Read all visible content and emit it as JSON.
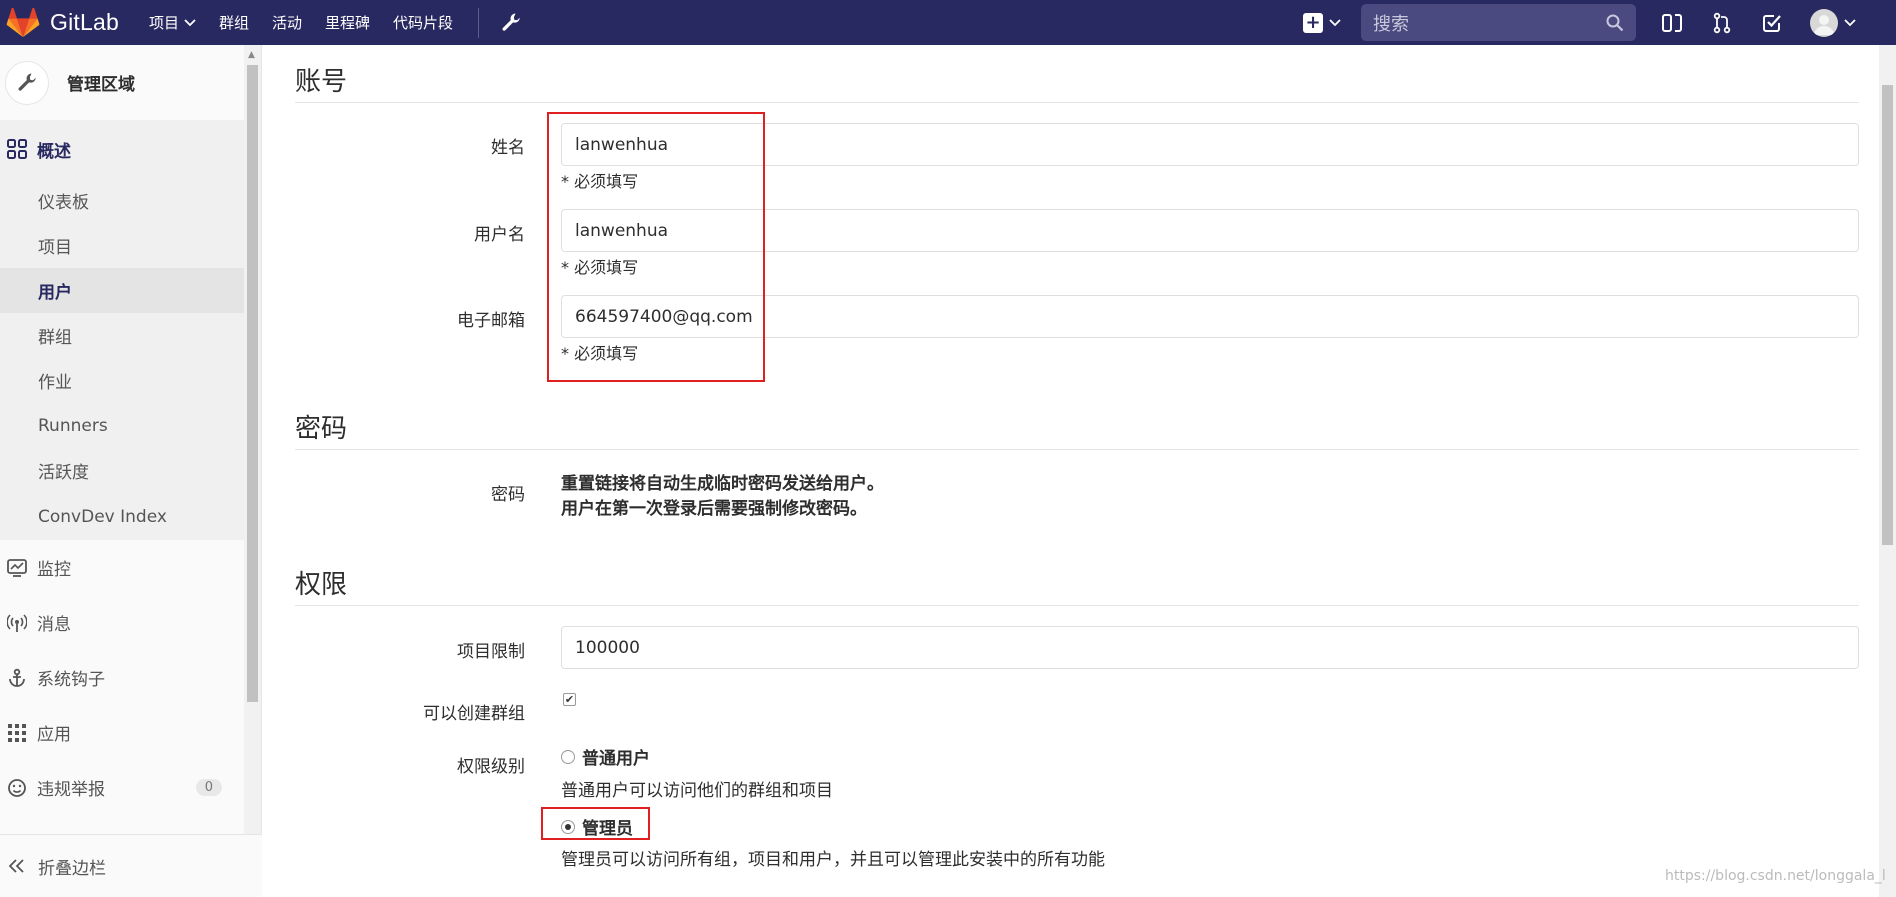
{
  "topbar": {
    "brand": "GitLab",
    "nav": [
      "项目",
      "群组",
      "活动",
      "里程碑",
      "代码片段"
    ],
    "search_placeholder": "搜索"
  },
  "sidebar": {
    "title": "管理区域",
    "overview": "概述",
    "sub_items": [
      "仪表板",
      "项目",
      "用户",
      "群组",
      "作业",
      "Runners",
      "活跃度",
      "ConvDev Index"
    ],
    "active_sub": "用户",
    "items": [
      {
        "label": "监控",
        "icon": "monitor-icon"
      },
      {
        "label": "消息",
        "icon": "broadcast-icon"
      },
      {
        "label": "系统钩子",
        "icon": "anchor-icon"
      },
      {
        "label": "应用",
        "icon": "apps-grid-icon"
      },
      {
        "label": "违规举报",
        "icon": "smiley-icon",
        "badge": "0"
      }
    ],
    "collapse_label": "折叠边栏"
  },
  "account": {
    "heading": "账号",
    "name_label": "姓名",
    "name_value": "lanwenhua",
    "username_label": "用户名",
    "username_value": "lanwenhua",
    "email_label": "电子邮箱",
    "email_value": "664597400@qq.com",
    "required_hint": "* 必须填写"
  },
  "password": {
    "heading": "密码",
    "label": "密码",
    "line1": "重置链接将自动生成临时密码发送给用户。",
    "line2": "用户在第一次登录后需要强制修改密码。"
  },
  "access": {
    "heading": "权限",
    "project_limit_label": "项目限制",
    "project_limit_value": "100000",
    "can_create_group_label": "可以创建群组",
    "can_create_group_checked": true,
    "level_label": "权限级别",
    "regular_label": "普通用户",
    "regular_desc": "普通用户可以访问他们的群组和项目",
    "admin_label": "管理员",
    "admin_desc": "管理员可以访问所有组，项目和用户，并且可以管理此安装中的所有功能",
    "selected": "管理员"
  },
  "watermark": "https://blog.csdn.net/longgala_l",
  "colors": {
    "topbar": "#292961",
    "highlight_box": "#e02020"
  }
}
